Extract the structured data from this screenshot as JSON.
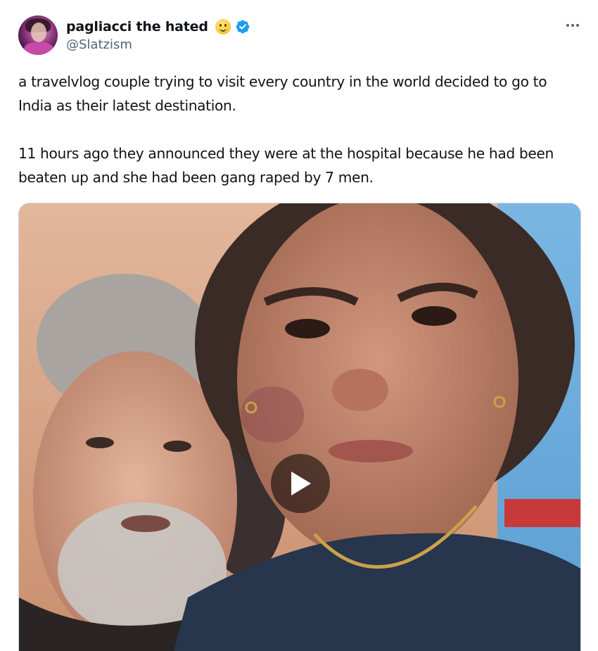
{
  "author": {
    "display_name": "pagliacci the hated",
    "handle": "@Slatzism",
    "name_emoji_icon": "slightly-smiling-face-emoji",
    "verified_icon": "verified-badge-icon",
    "verified_color": "#1d9bf0"
  },
  "menu": {
    "icon": "more-options-icon"
  },
  "tweet": {
    "paragraphs": [
      "a travelvlog couple trying to visit every country in the world decided to go to India as their latest destination.",
      "11 hours ago they announced they were at the hospital because he had been beaten up and she had been gang raped by 7 men."
    ]
  },
  "media": {
    "type": "video",
    "play_icon": "play-icon"
  },
  "colors": {
    "text_primary": "#0f1419",
    "text_secondary": "#536471",
    "border": "#cfd9de"
  }
}
